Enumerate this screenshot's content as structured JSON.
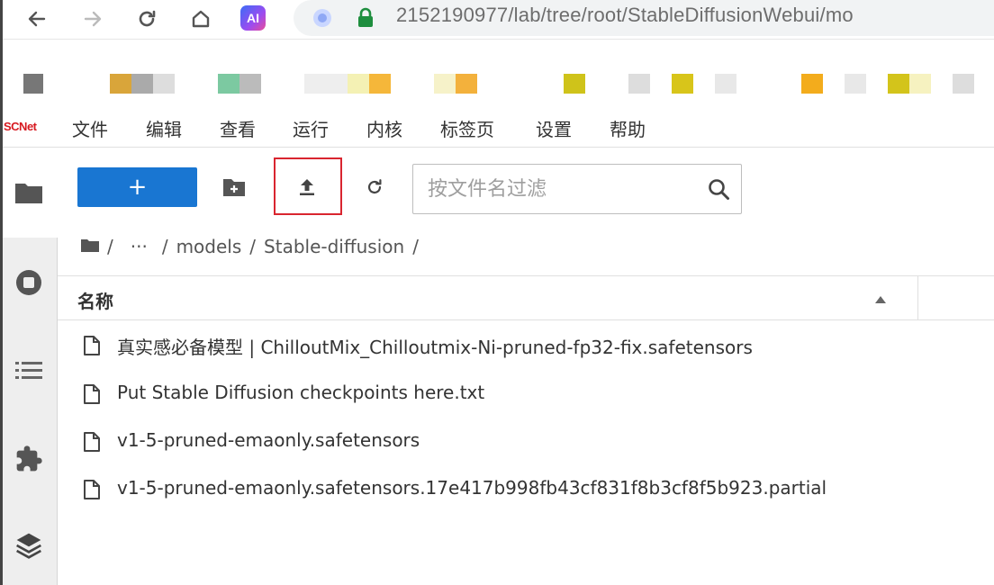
{
  "browser": {
    "address": "2152190977/lab/tree/root/StableDiffusionWebui/mo"
  },
  "app": {
    "logo": "SCNet",
    "menu": [
      "文件",
      "编辑",
      "查看",
      "运行",
      "内核",
      "标签页",
      "设置",
      "帮助"
    ]
  },
  "toolbar": {
    "new_label": "+",
    "search_placeholder": "按文件名过滤"
  },
  "breadcrumb": {
    "sep1": "/",
    "ellipsis": "···",
    "sep2": "/",
    "models": "models",
    "sep3": "/",
    "stable": "Stable-diffusion",
    "sep4": "/"
  },
  "list": {
    "header_name": "名称",
    "files": [
      "真实感必备模型 | ChilloutMix_Chilloutmix-Ni-pruned-fp32-fix.safetensors",
      "Put Stable Diffusion checkpoints here.txt",
      "v1-5-pruned-emaonly.safetensors",
      "v1-5-pruned-emaonly.safetensors.17e417b998fb43cf831f8b3cf8f5b923.partial"
    ]
  },
  "colors": {
    "accent": "#1976d2",
    "highlight": "#d9252f",
    "logo": "#d71920"
  }
}
